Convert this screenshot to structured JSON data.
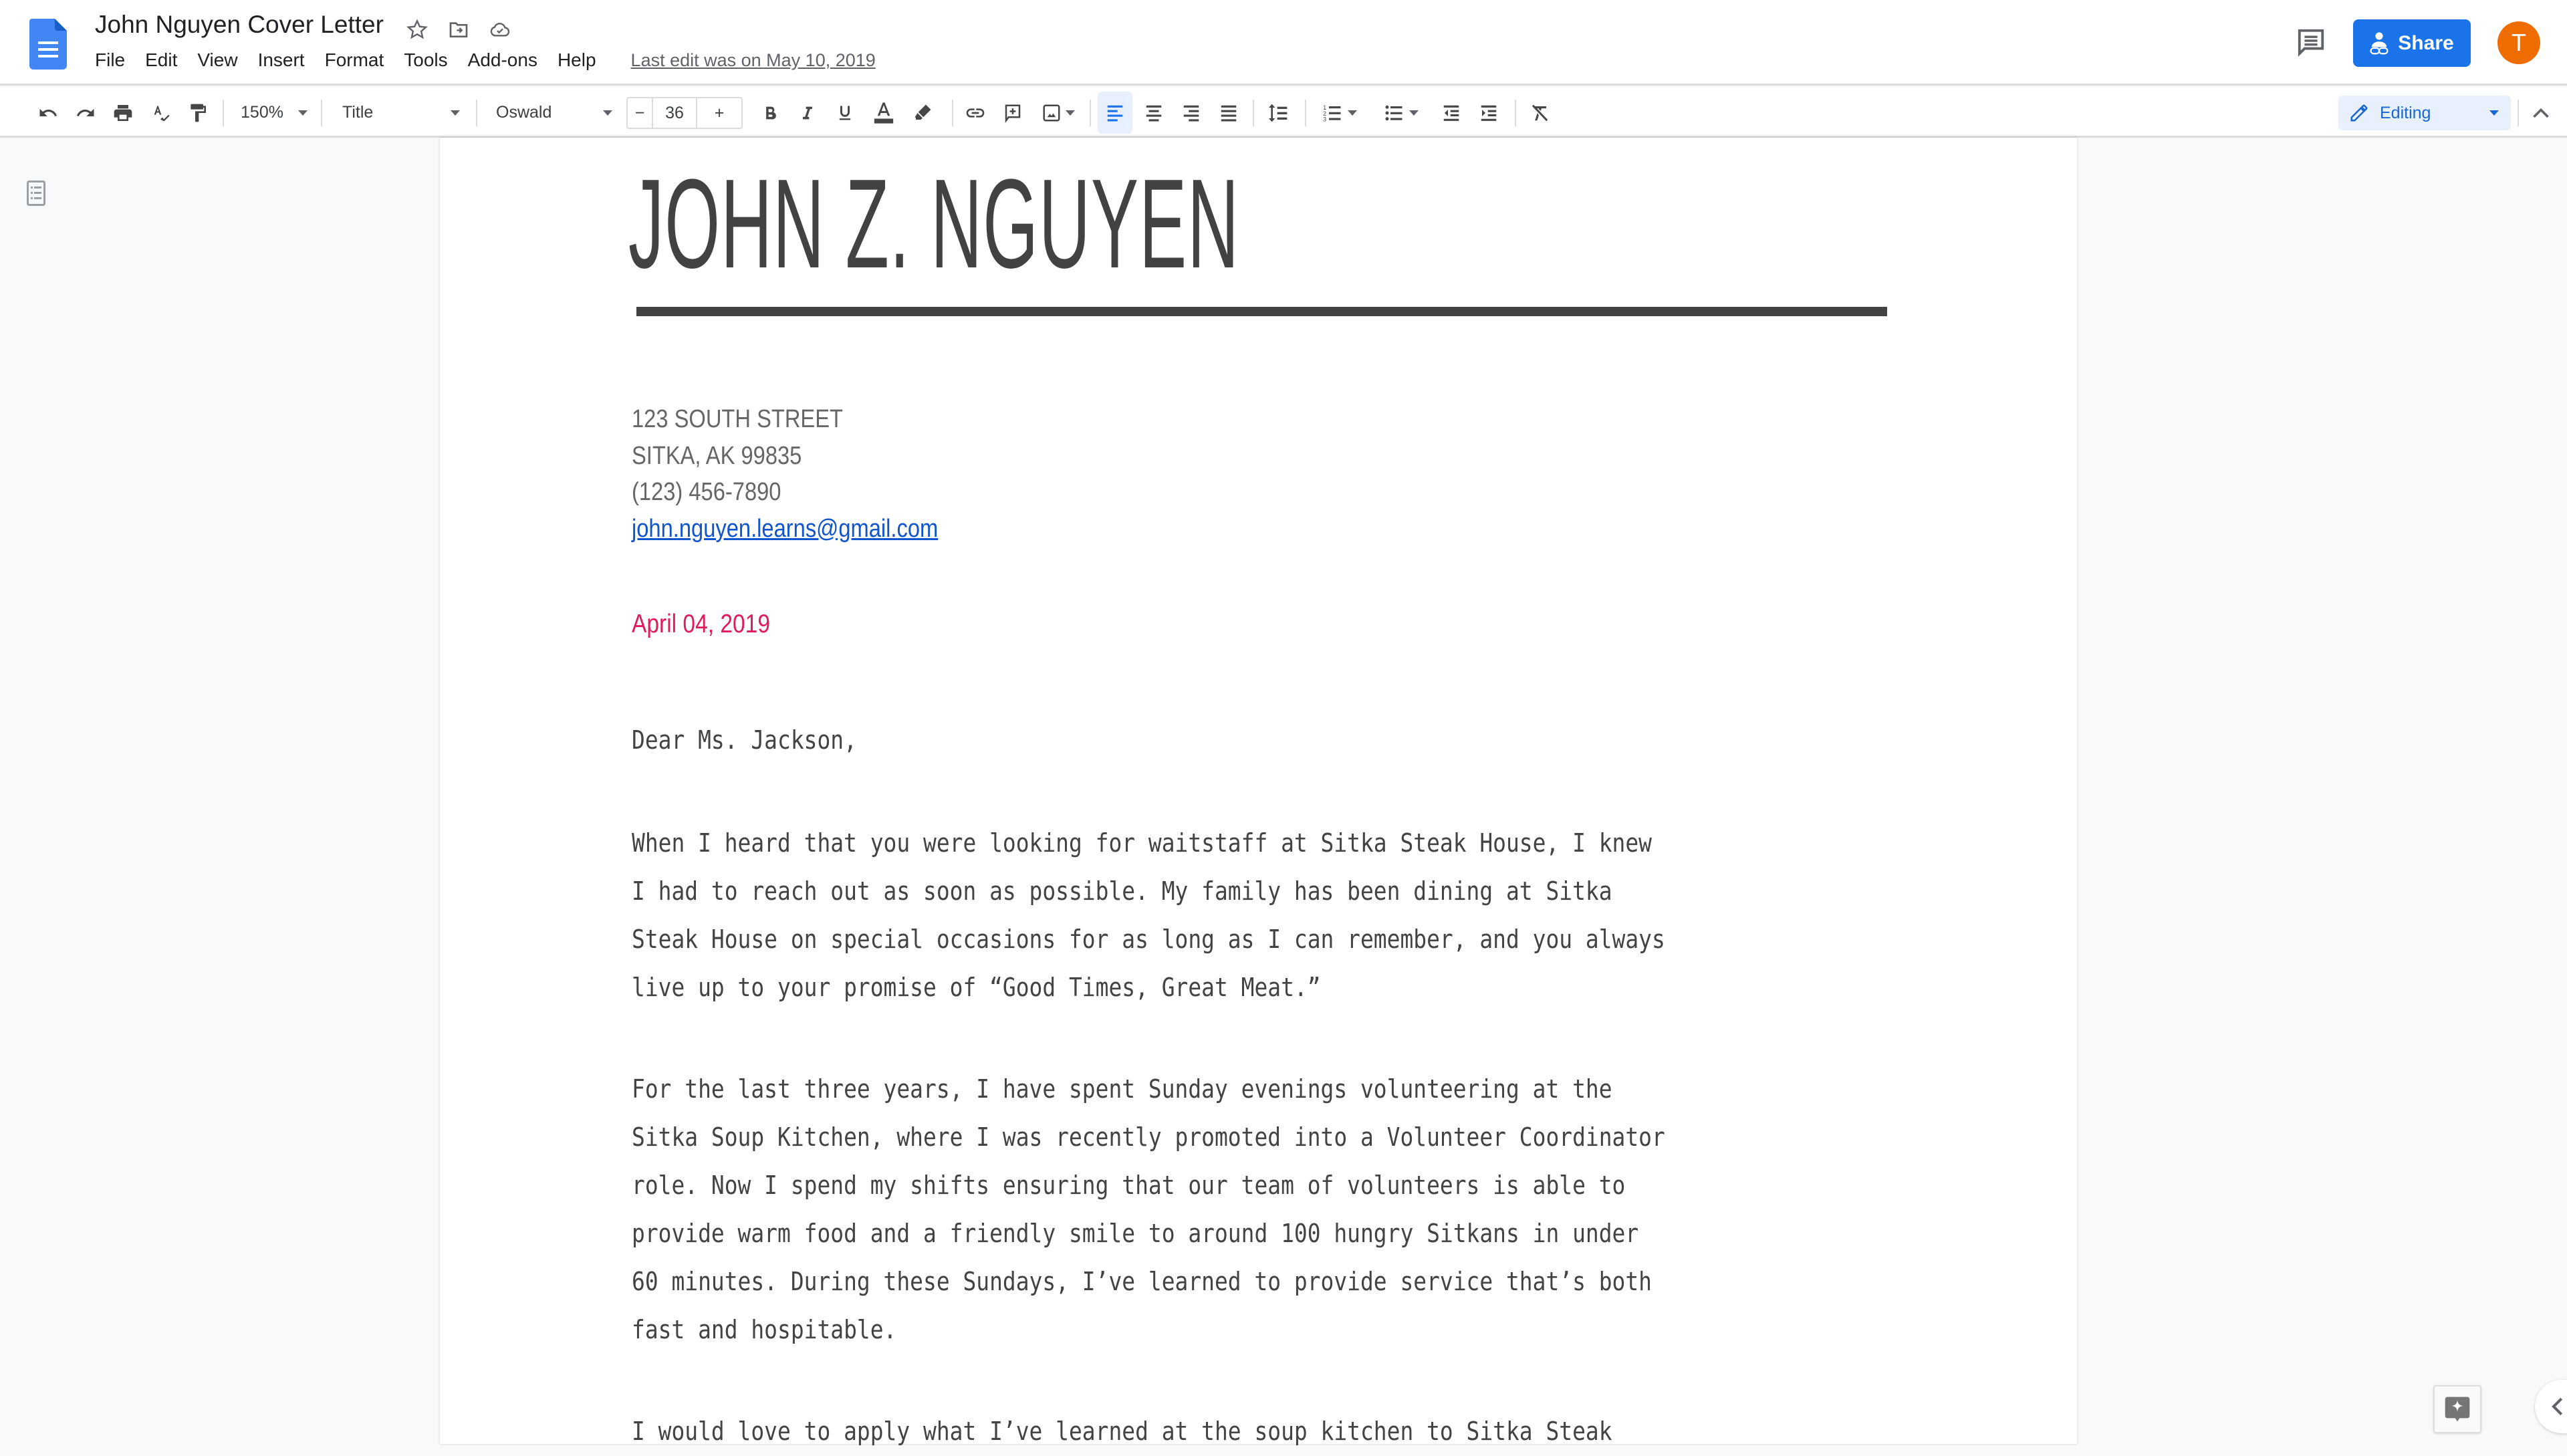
{
  "header": {
    "doc_title": "John Nguyen Cover Letter",
    "menu": [
      "File",
      "Edit",
      "View",
      "Insert",
      "Format",
      "Tools",
      "Add-ons",
      "Help"
    ],
    "last_edit": "Last edit was on May 10, 2019",
    "share_label": "Share",
    "avatar_initial": "T",
    "title_icons": [
      "star-icon",
      "move-to-folder-icon",
      "cloud-saved-icon"
    ]
  },
  "toolbar": {
    "zoom": "150%",
    "style": "Title",
    "font": "Oswald",
    "font_size": "36",
    "minus": "−",
    "plus": "+",
    "mode": "Editing",
    "active_alignment": "left"
  },
  "document": {
    "name": "JOHN Z. NGUYEN",
    "address_line1": "123 SOUTH STREET",
    "address_line2": "SITKA, AK 99835",
    "phone": "(123) 456-7890",
    "email": "john.nguyen.learns@gmail.com",
    "date": "April 04, 2019",
    "salutation": "Dear Ms. Jackson,",
    "paragraph1": "When I heard that you were looking for waitstaff at Sitka Steak House, I knew\nI had to reach out as soon as possible. My family has been dining at Sitka\nSteak House on special occasions for as long as I can remember, and you always\nlive up to your promise of “Good Times, Great Meat.”",
    "paragraph2": "For the last three years, I have spent Sunday evenings volunteering at the\nSitka Soup Kitchen, where I was recently promoted into a Volunteer Coordinator\nrole. Now I spend my shifts ensuring that our team of volunteers is able to\nprovide warm food and a friendly smile to around 100 hungry Sitkans in under\n60 minutes. During these Sundays, I’ve learned to provide service that’s both\nfast and hospitable.",
    "paragraph3": "I would love to apply what I’ve learned at the soup kitchen to Sitka Steak"
  },
  "colors": {
    "accent": "#1a73e8",
    "avatar": "#ef6c00",
    "date_text": "#e01b5b",
    "link": "#1155cc",
    "title_text": "#424242"
  }
}
